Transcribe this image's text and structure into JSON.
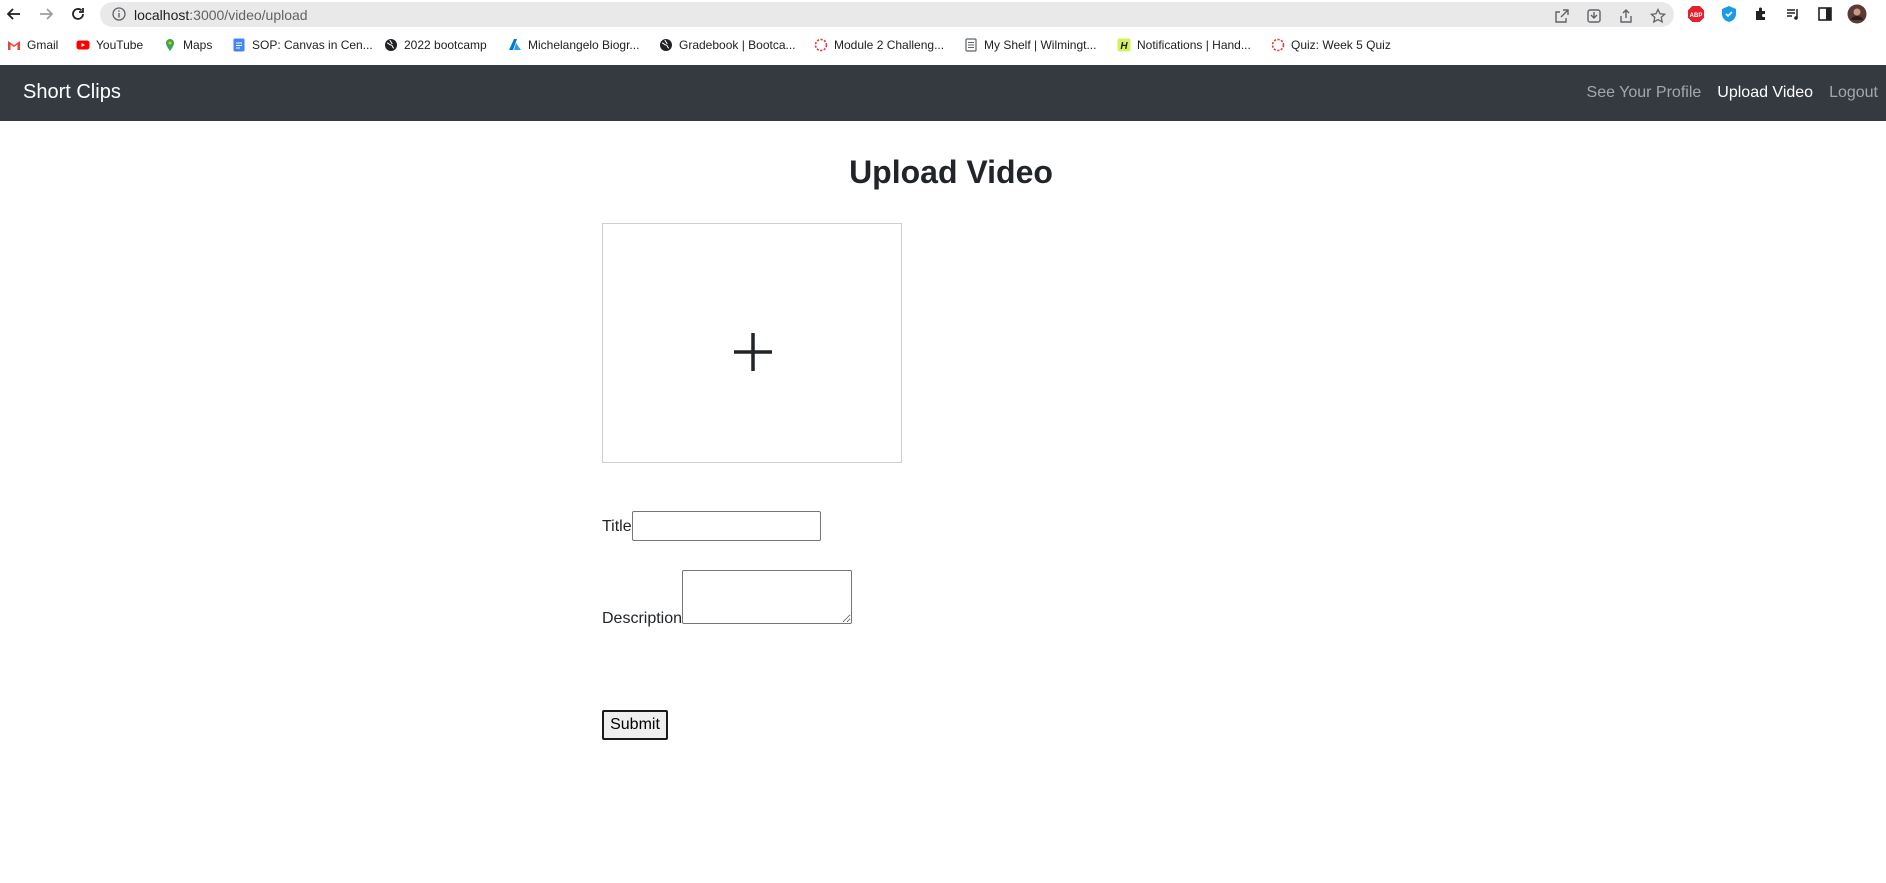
{
  "browser": {
    "url_host": "localhost",
    "url_rest": ":3000/video/upload",
    "bookmarks": [
      {
        "label": "Gmail",
        "icon": "gmail-icon",
        "color": "#ea4335"
      },
      {
        "label": "YouTube",
        "icon": "youtube-icon",
        "color": "#ff0000"
      },
      {
        "label": "Maps",
        "icon": "maps-icon",
        "color": "#34a853"
      },
      {
        "label": "SOP: Canvas in Cen...",
        "icon": "docs-icon",
        "color": "#4285f4"
      },
      {
        "label": "2022 bootcamp",
        "icon": "globe-icon",
        "color": "#202124"
      },
      {
        "label": "Michelangelo Biogr...",
        "icon": "azure-icon",
        "color": "#0078d4"
      },
      {
        "label": "Gradebook | Bootca...",
        "icon": "globe-icon",
        "color": "#202124"
      },
      {
        "label": "Module 2 Challeng...",
        "icon": "canvas-icon",
        "color": "#e03a3e"
      },
      {
        "label": "My Shelf | Wilmingt...",
        "icon": "page-icon",
        "color": "#5f6368"
      },
      {
        "label": "Notifications | Hand...",
        "icon": "handshake-icon",
        "color": "#d2f35c"
      },
      {
        "label": "Quiz: Week 5 Quiz",
        "icon": "canvas-icon",
        "color": "#e03a3e"
      }
    ]
  },
  "navbar": {
    "brand": "Short Clips",
    "links": [
      {
        "label": "See Your Profile",
        "active": false
      },
      {
        "label": "Upload Video",
        "active": true
      },
      {
        "label": "Logout",
        "active": false
      }
    ]
  },
  "main": {
    "title": "Upload Video",
    "dropzone_icon": "plus-icon",
    "title_label": "Title",
    "title_value": "",
    "description_label": "Description",
    "description_value": "",
    "submit_label": "Submit"
  }
}
